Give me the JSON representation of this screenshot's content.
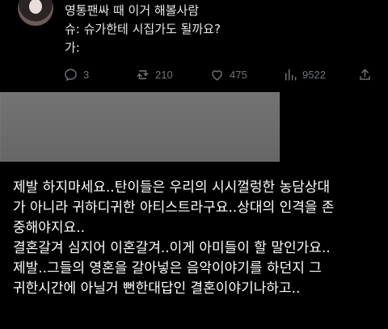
{
  "tweet": {
    "lines": [
      "영통팬싸 때 이거 해볼사람",
      "슈: 슈가한테 시집가도 될까요?",
      "가:"
    ]
  },
  "actions": {
    "reply": {
      "icon": "reply-icon",
      "count": "3"
    },
    "retweet": {
      "icon": "retweet-icon",
      "count": "210"
    },
    "like": {
      "icon": "heart-icon",
      "count": "475"
    },
    "views": {
      "icon": "views-icon",
      "count": "9522"
    },
    "share": {
      "icon": "share-icon"
    }
  },
  "caption": {
    "lines": [
      "제발 하지마세요..탄이들은 우리의 시시껄렁한 농담상대",
      "가 아니라 귀하디귀한 아티스트라구요..상대의 인격을 존",
      "중해야지요..",
      "결혼갈겨 심지어 이혼갈겨..이게 아미들이 할 말인가요..",
      "제발..그들의 영혼을 갈아넣은 음악이야기를 하던지 그",
      "귀한시간에 아닐거 뻔한대답인 결혼이야기나하고.."
    ]
  },
  "colors": {
    "background": "#000000",
    "text": "#e7e9ea",
    "muted": "#71767b",
    "card": "#6f6f6f"
  }
}
